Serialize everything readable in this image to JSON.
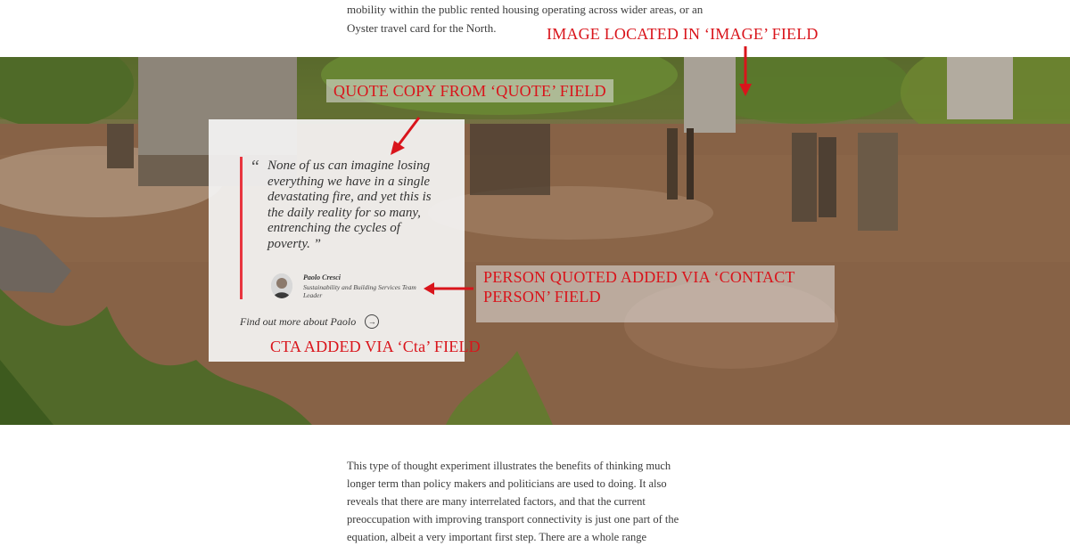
{
  "article": {
    "intro_line1": "mobility within the public rented housing operating across wider areas, or an",
    "intro_line2": "Oyster travel card for the North.",
    "body_paragraph": "This type of thought experiment illustrates the benefits of thinking much longer term than policy makers and politicians are used to doing. It also reveals that there are many interrelated factors, and that the current preoccupation with improving transport connectivity is just one part of the equation, albeit a very important first step. There are a whole range"
  },
  "quote": {
    "mark": "“",
    "text": "None of us can imagine losing everything we have in a single devastating fire, and yet this is the daily reality for so many, entrenching the cycles of poverty. ”",
    "person_name": "Paolo Cresci",
    "person_role": "Sustainability and Building Services Team Leader",
    "cta_label": "Find out more about Paolo",
    "cta_icon": "arrow-right-circle-icon"
  },
  "annotations": {
    "image": "IMAGE LOCATED IN ‘IMAGE’ FIELD",
    "quote": "QUOTE COPY FROM ‘QUOTE’ FIELD",
    "person": "PERSON QUOTED ADDED VIA ‘CONTACT PERSON’ FIELD",
    "cta": "CTA ADDED VIA ‘Cta’ FIELD"
  },
  "colors": {
    "annotation": "#d9141b",
    "quote_accent": "#e8353f",
    "body_text": "#3a3a3a"
  }
}
